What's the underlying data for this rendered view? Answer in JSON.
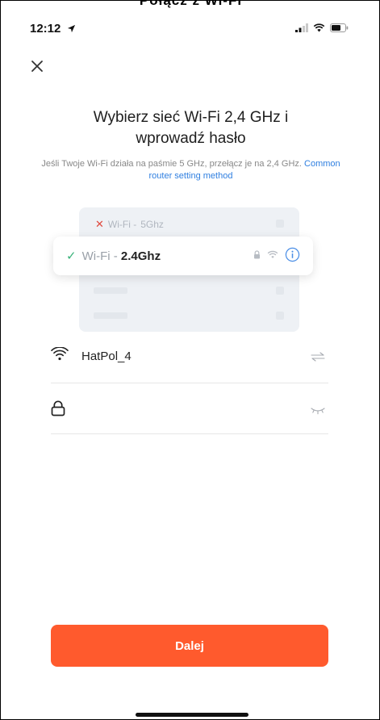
{
  "top_banner": {
    "text": "Połącz z Wi-Fi"
  },
  "status_bar": {
    "time": "12:12"
  },
  "page": {
    "title_line1": "Wybierz sieć Wi-Fi 2,4 GHz i",
    "title_line2": "wprowadź hasło",
    "subtitle": "Jeśli Twoje Wi-Fi działa na paśmie 5 GHz, przełącz je na 2,4 GHz.",
    "subtitle_link": "Common router setting method"
  },
  "illustration": {
    "row_5ghz": {
      "prefix": "Wi-Fi - ",
      "band": "5Ghz"
    },
    "row_24ghz": {
      "prefix": "Wi-Fi - ",
      "band": "2.4Ghz"
    }
  },
  "wifi_field": {
    "value": "HatPol_4"
  },
  "password_field": {
    "value": ""
  },
  "next_button": {
    "label": "Dalej"
  },
  "colors": {
    "accent": "#ff5a2d",
    "link": "#2f7fe0",
    "check": "#39b27a",
    "cross": "#e0493e"
  },
  "icons": [
    "close-icon",
    "location-arrow-icon",
    "signal-icon",
    "wifi-icon",
    "battery-icon",
    "lock-icon",
    "info-icon",
    "switch-network-icon",
    "eye-closed-icon"
  ]
}
